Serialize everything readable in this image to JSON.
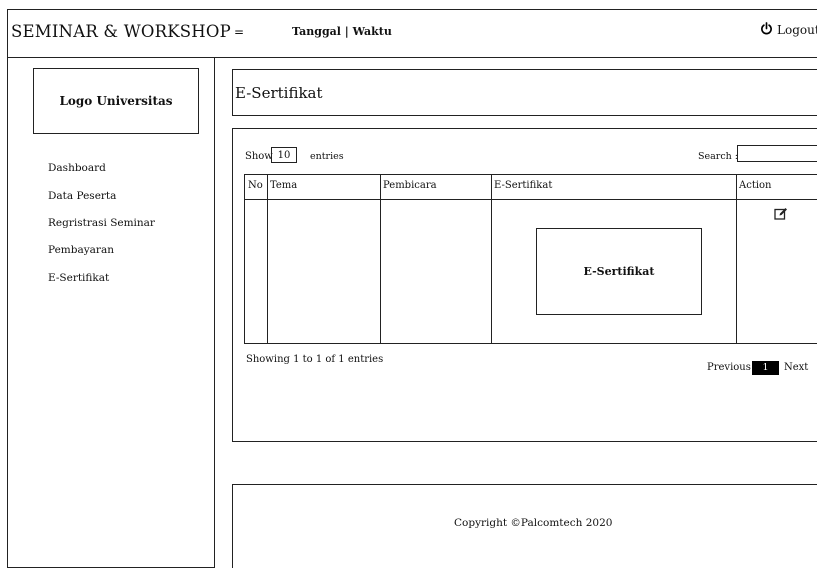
{
  "header": {
    "app_title": "SEMINAR & WORKSHOP",
    "menu_symbol": "=",
    "datetime": "Tanggal | Waktu",
    "logout_label": "Logout"
  },
  "sidebar": {
    "logo": "Logo Universitas",
    "items": [
      {
        "label": "Dashboard"
      },
      {
        "label": "Data Peserta"
      },
      {
        "label": "Regristrasi Seminar"
      },
      {
        "label": "Pembayaran"
      },
      {
        "label": "E-Sertifikat"
      }
    ]
  },
  "main": {
    "title": "E-Sertifikat",
    "table_controls": {
      "show_label": "Show",
      "entries_value": "10",
      "entries_label": "entries",
      "search_label": "Search :",
      "search_value": ""
    },
    "table": {
      "columns": [
        "No",
        "Tema",
        "Pembicara",
        "E-Sertifikat",
        "Action"
      ],
      "row": {
        "certificate_placeholder": "E-Sertifikat",
        "action_icon": "edit-icon"
      }
    },
    "pagination": {
      "info": "Showing 1 to 1 of 1 entries",
      "previous": "Previous",
      "current_page": "1",
      "next": "Next"
    }
  },
  "footer": {
    "copyright": "Copyright ©Palcomtech 2020"
  }
}
